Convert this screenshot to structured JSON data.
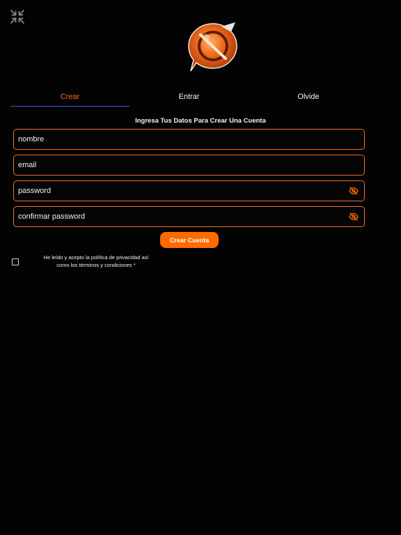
{
  "tabs": {
    "crear": "Crear",
    "entrar": "Entrar",
    "olvide": "Olvide"
  },
  "form": {
    "heading": "Ingresa Tus Datos Para Crear Una Cuenta",
    "nombre_placeholder": "nombre",
    "email_placeholder": "email",
    "password_placeholder": "password",
    "confirm_password_placeholder": "confirmar password",
    "submit_label": "Crear Cuenta",
    "terms_text_line1": "He leído y acepto la política de privacidad así",
    "terms_text_line2": "como los términos y condiciones *",
    "terms_checked": false
  },
  "colors": {
    "background": "#030303",
    "accent": "#ff6a00",
    "field_border": "#f36d22",
    "tab_indicator": "#4f4fd8"
  },
  "icons": {
    "collapse": "collapse-arrows-icon",
    "password_toggle": "eye-off-icon",
    "logo": "app-logo"
  }
}
